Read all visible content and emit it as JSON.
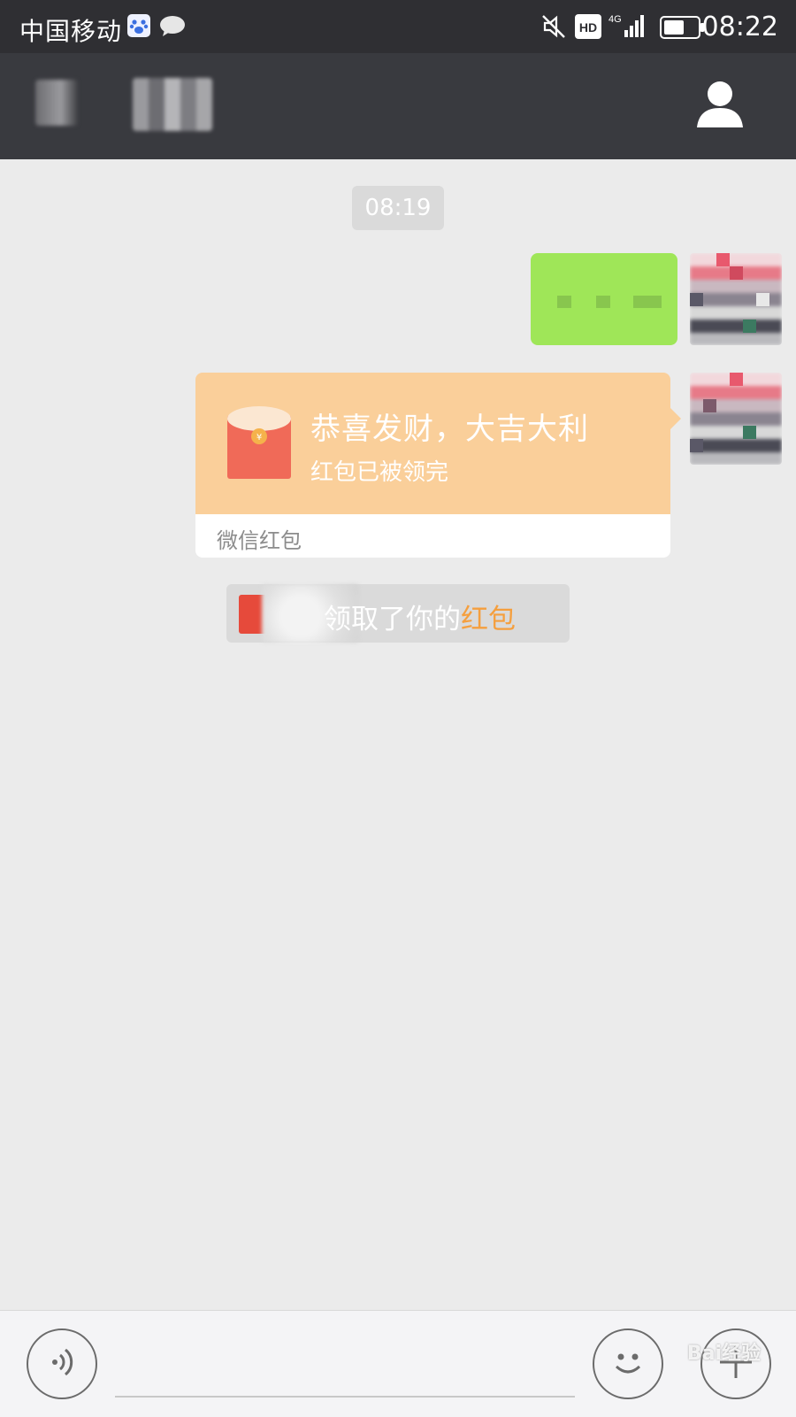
{
  "status_bar": {
    "carrier": "中国移动",
    "time": "08:22",
    "network": "4G",
    "hd_label": "HD"
  },
  "title_bar": {
    "back_icon": "back-arrow-icon",
    "contact_name_blurred": true,
    "profile_icon": "person-icon"
  },
  "chat": {
    "timestamp": "08:19",
    "messages": [
      {
        "type": "text",
        "from": "me",
        "text_blurred": true
      },
      {
        "type": "red_packet",
        "from": "me",
        "title": "恭喜发财，大吉大利",
        "status": "红包已被领完",
        "brand": "微信红包"
      }
    ],
    "system_notice": {
      "prefix": "领取了你的",
      "highlight": "红包",
      "highlight_color": "#f59f3e"
    }
  },
  "input_bar": {
    "voice_icon": "voice-icon",
    "emoji_icon": "emoji-icon",
    "plus_icon": "plus-icon"
  },
  "watermark": "Bai经验",
  "colors": {
    "title_bar": "#393a3f",
    "chat_bg": "#ebebeb",
    "green_bubble": "#9fe658",
    "red_packet": "#facf9a"
  }
}
